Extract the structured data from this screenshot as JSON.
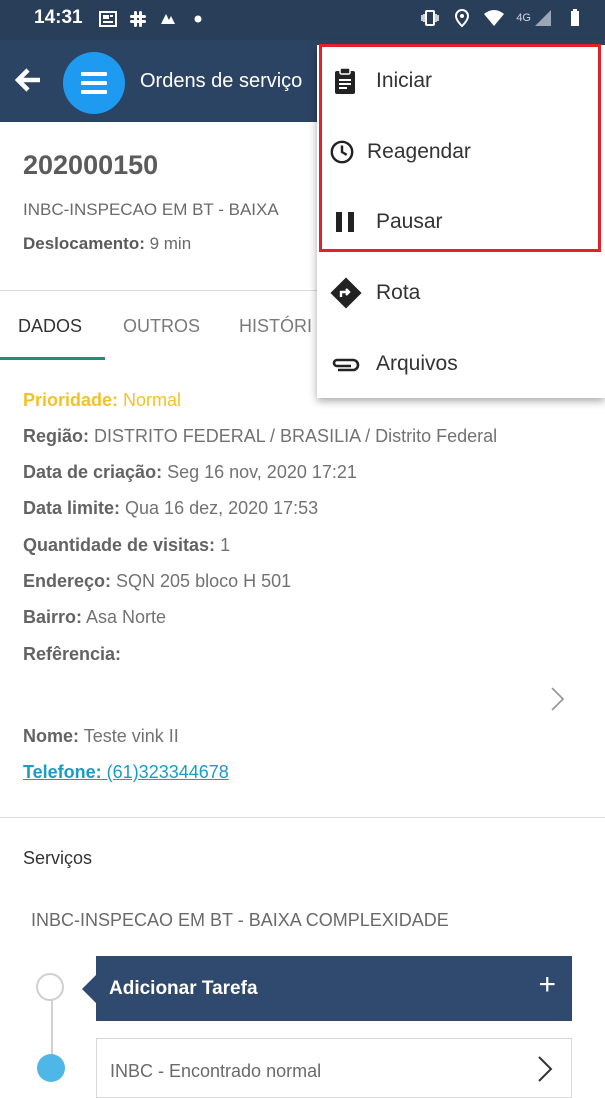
{
  "status_bar": {
    "time": "14:31",
    "network": "4G",
    "icons_left": [
      "newspaper-icon",
      "slack-icon",
      "app-icon",
      "dot-icon"
    ],
    "icons_right": [
      "vibrate-icon",
      "location-icon",
      "wifi-icon",
      "signal-icon",
      "battery-icon"
    ]
  },
  "app_bar": {
    "title": "Ordens de serviço",
    "back_icon": "back-arrow-icon",
    "menu_icon": "hamburger-icon"
  },
  "order": {
    "number": "202000150",
    "type": "INBC-INSPECAO EM BT - BAIXA",
    "displacement_label": "Deslocamento:",
    "displacement_value": " 9 min"
  },
  "tabs": [
    "DADOS",
    "OUTROS",
    "HISTÓRI"
  ],
  "details": {
    "priority_label": "Prioridade:",
    "priority_value": " Normal",
    "region_label": "Região:",
    "region_value": " DISTRITO FEDERAL / BRASILIA / Distrito Federal",
    "created_label": "Data de criação:",
    "created_value": " Seg 16 nov, 2020 17:21",
    "deadline_label": "Data limite:",
    "deadline_value": " Qua 16 dez, 2020 17:53",
    "visits_label": "Quantidade de visitas:",
    "visits_value": " 1",
    "address_label": "Endereço:",
    "address_value": " SQN 205 bloco H 501",
    "district_label": "Bairro:",
    "district_value": " Asa Norte",
    "reference_label": "Refêrencia:",
    "name_label": "Nome:",
    "name_value": " Teste vink II",
    "phone_label": "Telefone:",
    "phone_value": " (61)323344678"
  },
  "services": {
    "title": "Serviços",
    "service_name": "INBC-INSPECAO EM BT - BAIXA COMPLEXIDADE",
    "add_task_label": "Adicionar Tarefa",
    "add_task_icon": "+",
    "task_label": "INBC - Encontrado normal"
  },
  "popup_menu": {
    "items": [
      {
        "label": "Iniciar",
        "icon": "clipboard-icon"
      },
      {
        "label": "Reagendar",
        "icon": "clock-icon"
      },
      {
        "label": "Pausar",
        "icon": "pause-icon"
      },
      {
        "label": "Rota",
        "icon": "directions-icon"
      },
      {
        "label": "Arquivos",
        "icon": "attachment-icon"
      }
    ]
  },
  "colors": {
    "header": "#2c4463",
    "status_bar": "#283e59",
    "accent_blue": "#1e9bf0",
    "tab_indicator": "#1a8f7b",
    "priority": "#f2c22a",
    "link": "#1a9cc7",
    "highlight": "#e4202b"
  }
}
